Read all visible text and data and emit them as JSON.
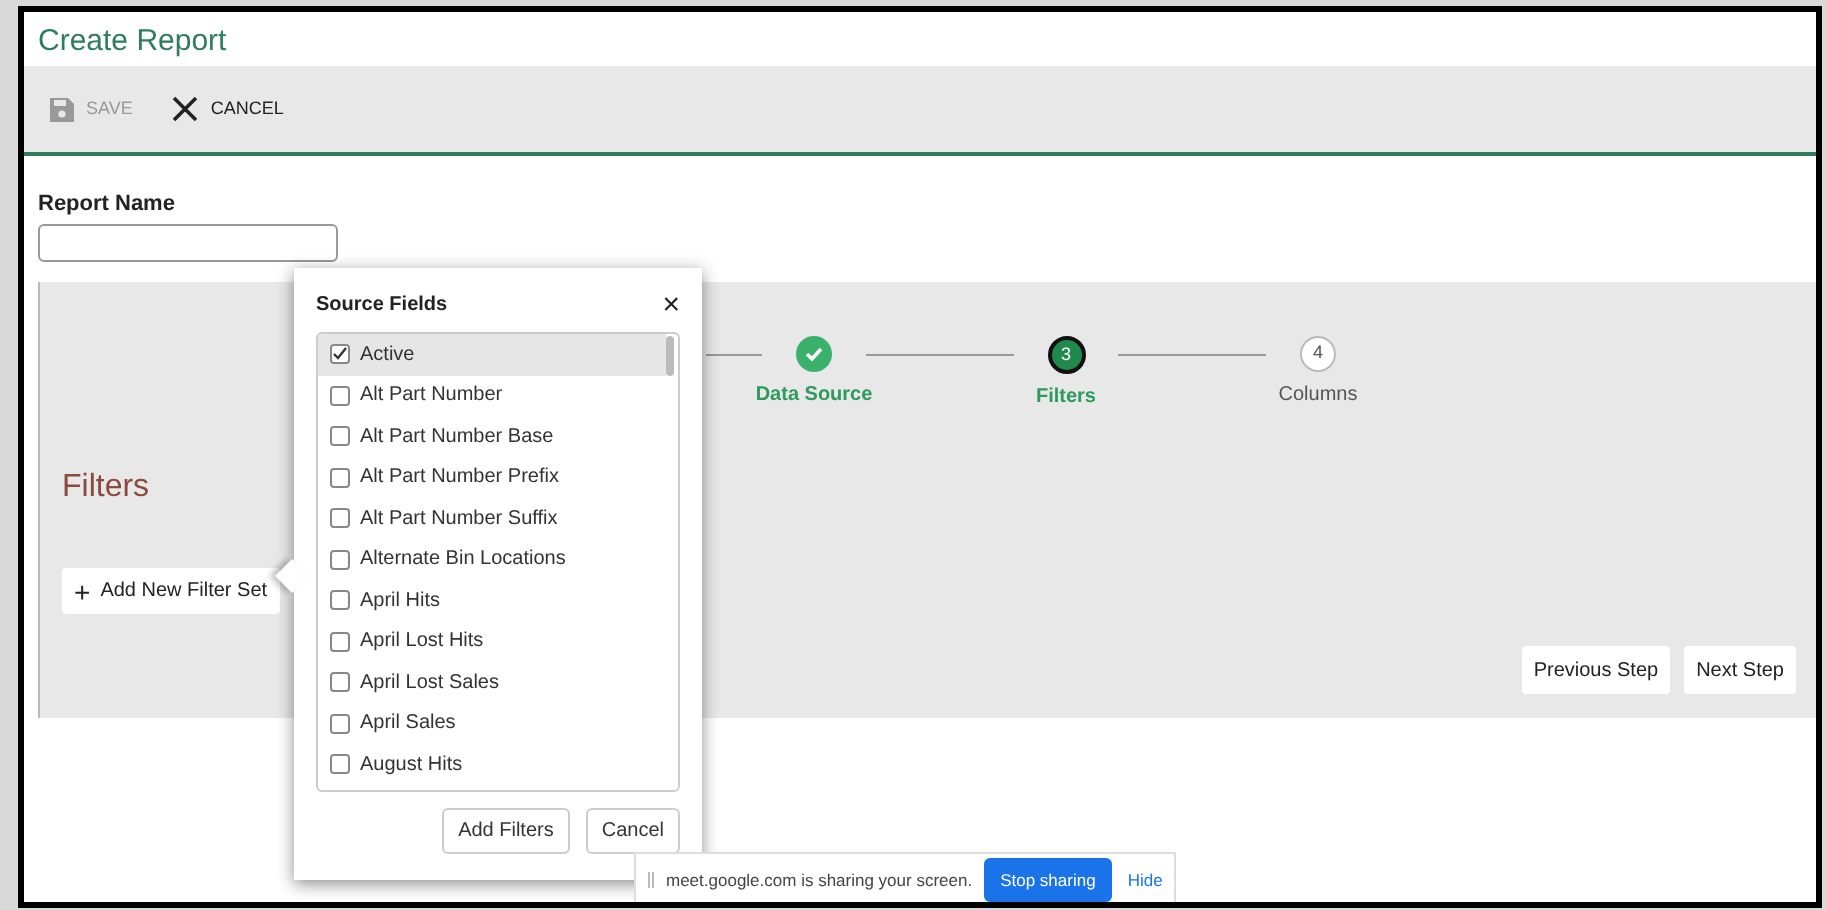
{
  "window": {
    "title": "Create Report"
  },
  "toolbar": [
    {
      "label": "SAVE",
      "kind": "save",
      "disabled": true
    },
    {
      "label": "CANCEL",
      "kind": "cancel",
      "disabled": false
    }
  ],
  "report_name": {
    "label": "Report Name"
  },
  "stepper": [
    {
      "label": "Data Source",
      "kind": "done"
    },
    {
      "label": "Filters",
      "kind": "current",
      "number": "3"
    },
    {
      "label": "Columns",
      "kind": "pending",
      "number": "4"
    }
  ],
  "section_title": "Filters",
  "add_filter_button": {
    "icon": "+",
    "label": "Add New Filter Set"
  },
  "nav_buttons": [
    "Previous Step",
    "Next Step"
  ],
  "popover": {
    "title": "Source Fields",
    "close": "×",
    "fields": [
      {
        "label": "Active",
        "checked": true,
        "selected": true
      },
      {
        "label": "Alt Part Number",
        "checked": false,
        "selected": false
      },
      {
        "label": "Alt Part Number Base",
        "checked": false,
        "selected": false
      },
      {
        "label": "Alt Part Number Prefix",
        "checked": false,
        "selected": false
      },
      {
        "label": "Alt Part Number Suffix",
        "checked": false,
        "selected": false
      },
      {
        "label": "Alternate Bin Locations",
        "checked": false,
        "selected": false
      },
      {
        "label": "April Hits",
        "checked": false,
        "selected": false
      },
      {
        "label": "April Lost Hits",
        "checked": false,
        "selected": false
      },
      {
        "label": "April Lost Sales",
        "checked": false,
        "selected": false
      },
      {
        "label": "April Sales",
        "checked": false,
        "selected": false
      },
      {
        "label": "August Hits",
        "checked": false,
        "selected": false
      }
    ],
    "buttons": [
      "Add Filters",
      "Cancel"
    ]
  },
  "share_bar": {
    "message": "meet.google.com is sharing your screen.",
    "stop": "Stop sharing",
    "hide": "Hide"
  }
}
